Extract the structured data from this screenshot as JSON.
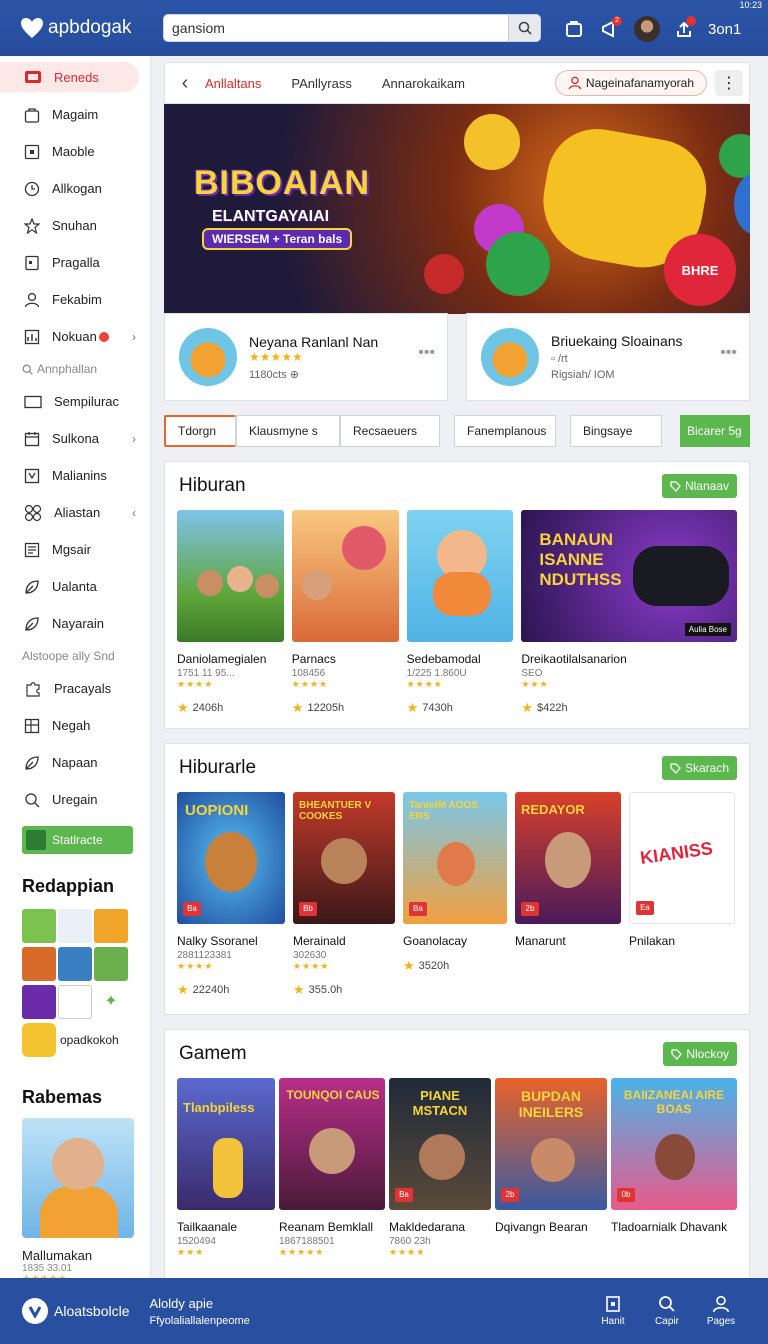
{
  "header": {
    "app_name": "apbdogak",
    "search_value": "gansiom",
    "user": "3on1",
    "notif_count": "2",
    "status": "10:23"
  },
  "sidebar": {
    "items": [
      {
        "label": "Reneds",
        "icon": "home-icon"
      },
      {
        "label": "Magaim",
        "icon": "bag-icon"
      },
      {
        "label": "Maoble",
        "icon": "square-icon"
      },
      {
        "label": "Allkogan",
        "icon": "clock-icon"
      },
      {
        "label": "Snuhan",
        "icon": "star-icon"
      },
      {
        "label": "Pragalla",
        "icon": "file-icon"
      },
      {
        "label": "Fekabim",
        "icon": "user-icon"
      },
      {
        "label": "Nokuan",
        "icon": "chart-icon"
      }
    ],
    "group1": "Annphallan",
    "items2": [
      {
        "label": "Sempilurac",
        "icon": "rect-icon"
      },
      {
        "label": "Sulkona",
        "icon": "calendar-icon"
      },
      {
        "label": "Malianins",
        "icon": "box-icon"
      },
      {
        "label": "Aliastan",
        "icon": "grid-icon"
      },
      {
        "label": "Mgsair",
        "icon": "doc-icon"
      },
      {
        "label": "Ualanta",
        "icon": "leaf-icon"
      },
      {
        "label": "Nayarain",
        "icon": "leaf-icon"
      }
    ],
    "group2": "Alstoope ally Snd",
    "items3": [
      {
        "label": "Pracayals",
        "icon": "puzzle-icon"
      },
      {
        "label": "Negah",
        "icon": "table-icon"
      },
      {
        "label": "Napaan",
        "icon": "leaf-icon"
      },
      {
        "label": "Uregain",
        "icon": "search-icon"
      }
    ],
    "green_button": "Statlracte",
    "apps_title": "Redappian",
    "side_app": "opadkokoh",
    "promo_title": "Rabemas",
    "promo_name": "Mallumakan",
    "promo_sub": "1835 33.01",
    "promo_stars": "★★★★★"
  },
  "tabs": {
    "items": [
      "Anllaltans",
      "PAnllyrass",
      "Annarokaikam"
    ],
    "cta": "Nageinafanamyorah"
  },
  "hero": {
    "title": "BIBOAIAN",
    "subtitle": "ELANTGAYAIAI",
    "pill": "WIERSEM + Teran bals",
    "ball_text": "BHRE"
  },
  "featured": [
    {
      "title": "Neyana Ranlanl Nan",
      "stars": "★★★★★",
      "sub": "1180cts ⊕"
    },
    {
      "title": "Briuekaing Sloainans",
      "stars": "▫ /rt",
      "sub": "Rigsiah/ IOM"
    }
  ],
  "chips": [
    "Tdorgn",
    "Klausmyne s",
    "Recsaeuers",
    "Fanemplanous",
    "Bingsaye",
    "Bicarer 5g"
  ],
  "sections": [
    {
      "title": "Hiburan",
      "button": "Nlanaav",
      "cards": [
        {
          "name": "Daniolamegialen",
          "sub": "1751 11 95...",
          "stars": "★★★★",
          "rate": "2406h"
        },
        {
          "name": "Parnacs",
          "sub": "108456",
          "stars": "★★★★",
          "rate": "12205h"
        },
        {
          "name": "Sedebamodal",
          "sub": "1/225 1.860U",
          "stars": "★★★★",
          "rate": "7430h"
        },
        {
          "name": "Dreikaotilalsanarion",
          "sub": "SEO",
          "stars": "★★★",
          "rate": "$422h",
          "banner": "BANAUN ISANNE NDUTHSS",
          "badge": "Aulia Bose"
        }
      ]
    },
    {
      "title": "Hiburarle",
      "button": "Skarach",
      "cards": [
        {
          "name": "Nalky Ssoranel",
          "sub": "2881123381",
          "stars": "★★★★",
          "rate": "22240h",
          "tag": "Ba",
          "art": "UOPIONI"
        },
        {
          "name": "Merainald",
          "sub": "302630",
          "stars": "★★★★",
          "rate": "355.0h",
          "tag": "Bb",
          "art": "BHEANTUER V COOKES"
        },
        {
          "name": "Goanolacay",
          "sub": "",
          "stars": "",
          "rate": "3520h",
          "tag": "Ba",
          "art": "TaniolM AOOS ERS"
        },
        {
          "name": "Manarunt",
          "sub": "",
          "stars": "",
          "rate": "",
          "tag": "2b",
          "art": "REDAYOR"
        },
        {
          "name": "Pnilakan",
          "sub": "",
          "stars": "",
          "rate": "",
          "tag": "Ea",
          "art": "KIANISS"
        }
      ]
    },
    {
      "title": "Gamem",
      "button": "Nlockoy",
      "cards": [
        {
          "name": "Tailkaanale",
          "sub": "1520494",
          "stars": "★★★",
          "rate": "",
          "art": "Tlanbpiless"
        },
        {
          "name": "Reanam Bemklall",
          "sub": "1867188501",
          "stars": "★★★★★",
          "rate": "",
          "art": "TOUNQOI CAUS"
        },
        {
          "name": "Makldedarana",
          "sub": "7860 23h",
          "stars": "★★★★",
          "rate": "",
          "tag": "Ba",
          "art": "PIANE MSTACN"
        },
        {
          "name": "Dqivangn Bearan",
          "sub": "",
          "stars": "",
          "rate": "",
          "tag": "2b",
          "art": "BUPDAN INEILERS"
        },
        {
          "name": "Tladoarnialk Dhavank",
          "sub": "",
          "stars": "",
          "rate": "",
          "tag": "0b",
          "art": "BAIIZANEAI AIRE BOAS"
        }
      ]
    }
  ],
  "bottom": {
    "brand": "Aloatsbolcle",
    "title": "Aloldy apie",
    "subtitle": "Ffyolaliallalenpeome",
    "nav": [
      "Hanit",
      "Capir",
      "Pages"
    ]
  }
}
